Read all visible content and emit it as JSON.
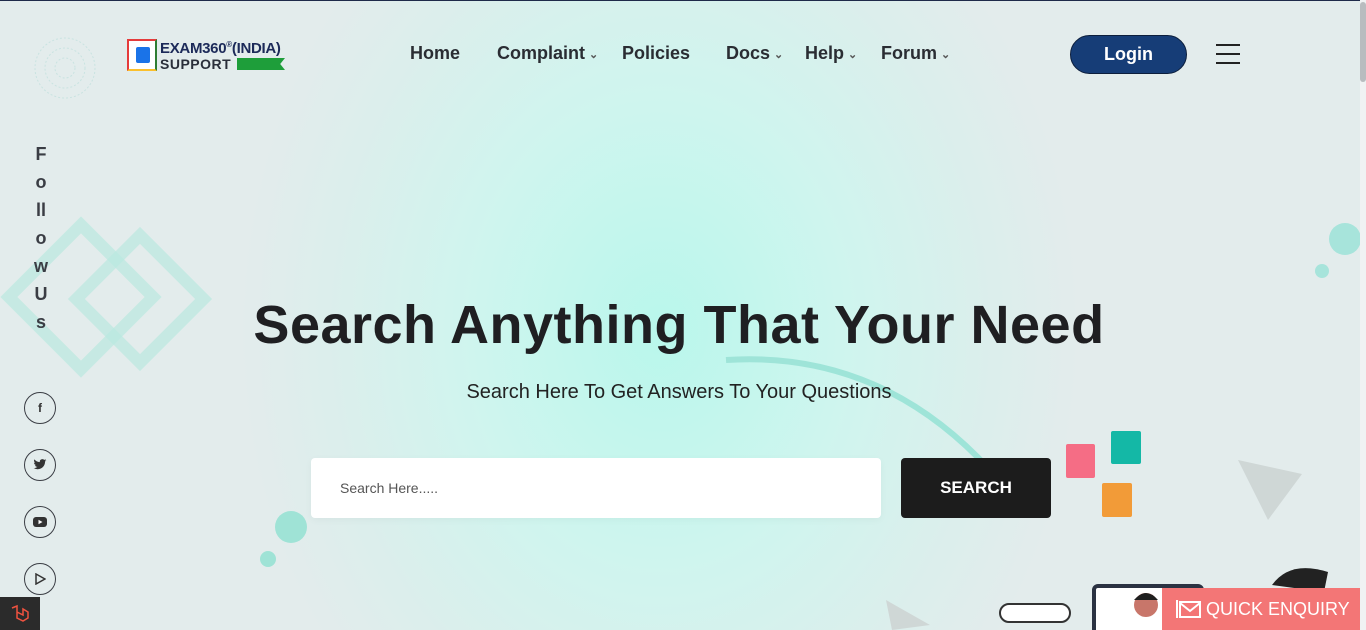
{
  "logo": {
    "line1": "EXAM360",
    "reg": "®",
    "line1_suffix": "(INDIA)",
    "line2": "SUPPORT"
  },
  "nav": {
    "items": [
      {
        "label": "Home",
        "dropdown": false
      },
      {
        "label": "Complaint",
        "dropdown": true
      },
      {
        "label": "Policies",
        "dropdown": false
      },
      {
        "label": "Docs",
        "dropdown": true
      },
      {
        "label": "Help",
        "dropdown": true
      },
      {
        "label": "Forum",
        "dropdown": true
      }
    ],
    "login_label": "Login",
    "menu_icon": "hamburger-icon"
  },
  "follow": {
    "label": "Follow Us",
    "socials": [
      {
        "icon": "facebook-icon",
        "glyph": "f"
      },
      {
        "icon": "twitter-icon",
        "glyph": "🐦"
      },
      {
        "icon": "youtube-icon",
        "glyph": "▶"
      },
      {
        "icon": "play-store-icon",
        "glyph": "▷"
      }
    ]
  },
  "hero": {
    "title": "Search Anything That Your Need",
    "subtitle": "Search Here To Get Answers To Your Questions",
    "search_placeholder": "Search Here.....",
    "search_button": "SEARCH"
  },
  "enquiry": {
    "label": "QUICK ENQUIRY"
  },
  "colors": {
    "login_bg": "#163d77",
    "search_btn_bg": "#1c1c1c",
    "enquiry_bg": "#f37676",
    "accent_teal": "#16b5a3"
  }
}
